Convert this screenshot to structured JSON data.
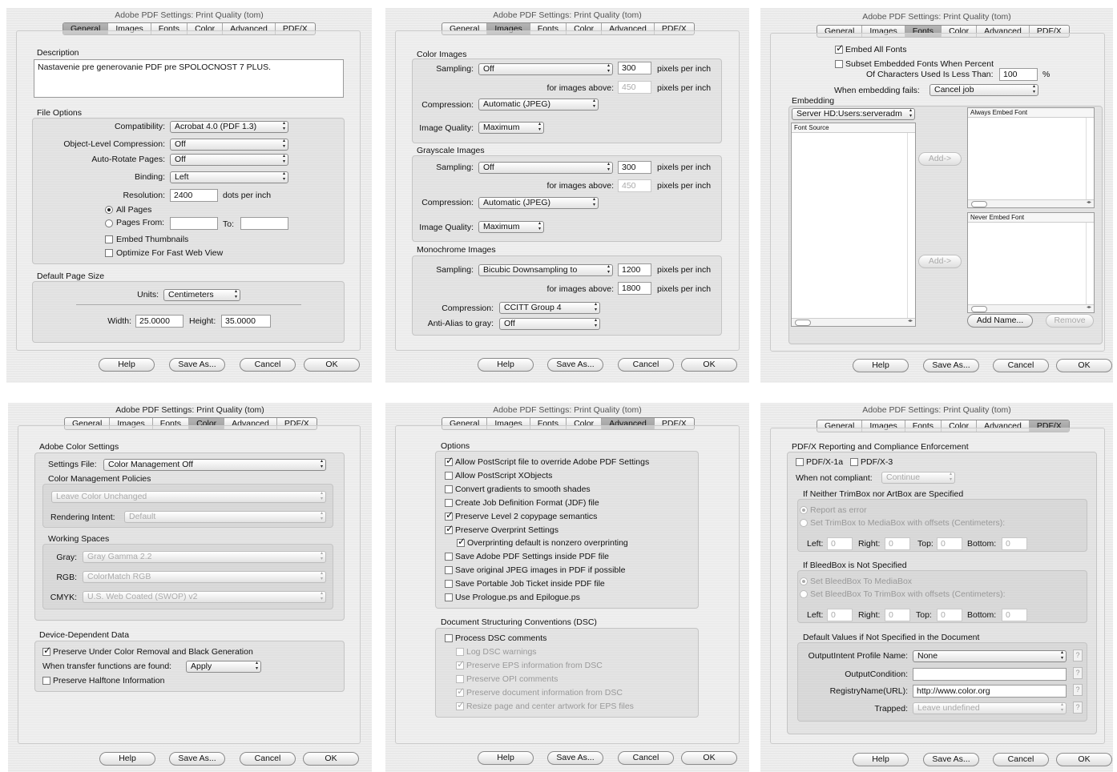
{
  "window_title": "Adobe PDF Settings: Print Quality (tom)",
  "tabs": [
    "General",
    "Images",
    "Fonts",
    "Color",
    "Advanced",
    "PDF/X"
  ],
  "buttons": {
    "help": "Help",
    "save_as": "Save As...",
    "cancel": "Cancel",
    "ok": "OK"
  },
  "general": {
    "description_label": "Description",
    "description": "Nastavenie pre generovanie PDF pre SPOLOCNOST 7 PLUS.",
    "file_options_label": "File Options",
    "compatibility_label": "Compatibility:",
    "compatibility": "Acrobat 4.0 (PDF 1.3)",
    "object_compression_label": "Object-Level Compression:",
    "object_compression": "Off",
    "auto_rotate_label": "Auto-Rotate Pages:",
    "auto_rotate": "Off",
    "binding_label": "Binding:",
    "binding": "Left",
    "resolution_label": "Resolution:",
    "resolution": "2400",
    "dpi": "dots per inch",
    "all_pages": "All Pages",
    "pages_from": "Pages From:",
    "to": "To:",
    "embed_thumbnails": "Embed Thumbnails",
    "optimize_web": "Optimize For Fast Web View",
    "page_size_label": "Default Page Size",
    "units_label": "Units:",
    "units": "Centimeters",
    "width_label": "Width:",
    "width": "25.0000",
    "height_label": "Height:",
    "height": "35.0000"
  },
  "images": {
    "color_label": "Color Images",
    "grayscale_label": "Grayscale Images",
    "mono_label": "Monochrome Images",
    "sampling_label": "Sampling:",
    "above_label": "for images above:",
    "ppi": "pixels per inch",
    "compression_label": "Compression:",
    "quality_label": "Image Quality:",
    "antialias_label": "Anti-Alias to gray:",
    "color": {
      "sampling": "Off",
      "ppi": "300",
      "above": "450",
      "compression": "Automatic (JPEG)",
      "quality": "Maximum"
    },
    "gray": {
      "sampling": "Off",
      "ppi": "300",
      "above": "450",
      "compression": "Automatic (JPEG)",
      "quality": "Maximum"
    },
    "mono": {
      "sampling": "Bicubic Downsampling to",
      "ppi": "1200",
      "above": "1800",
      "compression": "CCITT Group 4",
      "antialias": "Off"
    }
  },
  "fonts": {
    "embed_all": "Embed All Fonts",
    "subset_line1": "Subset Embedded Fonts When Percent",
    "subset_line2": "Of Characters Used Is Less Than:",
    "subset_value": "100",
    "percent": "%",
    "fails_label": "When embedding fails:",
    "fails": "Cancel job",
    "embedding_label": "Embedding",
    "source_path": "Server HD:Users:serveradm",
    "font_source": "Font Source",
    "always_embed": "Always Embed Font",
    "never_embed": "Never Embed Font",
    "add": "Add->",
    "add_name": "Add Name...",
    "remove": "Remove"
  },
  "color": {
    "adobe_label": "Adobe Color Settings",
    "settings_file_label": "Settings File:",
    "settings_file": "Color Management Off",
    "policies_label": "Color Management Policies",
    "policy": "Leave Color Unchanged",
    "intent_label": "Rendering Intent:",
    "intent": "Default",
    "working_label": "Working Spaces",
    "gray_label": "Gray:",
    "gray": "Gray Gamma 2.2",
    "rgb_label": "RGB:",
    "rgb": "ColorMatch RGB",
    "cmyk_label": "CMYK:",
    "cmyk": "U.S. Web Coated (SWOP) v2",
    "device_label": "Device-Dependent Data",
    "ucr": "Preserve Under Color Removal and Black Generation",
    "transfer_label": "When transfer functions are found:",
    "transfer": "Apply",
    "halftone": "Preserve Halftone Information"
  },
  "advanced": {
    "options_label": "Options",
    "options": [
      "Allow PostScript file to override Adobe PDF Settings",
      "Allow PostScript XObjects",
      "Convert gradients to smooth shades",
      "Create Job Definition Format (JDF) file",
      "Preserve Level 2 copypage semantics",
      "Preserve Overprint Settings",
      "Overprinting default is nonzero overprinting",
      "Save Adobe PDF Settings inside PDF file",
      "Save original JPEG images in PDF if possible",
      "Save Portable Job Ticket inside PDF file",
      "Use Prologue.ps and Epilogue.ps"
    ],
    "dsc_label": "Document Structuring Conventions (DSC)",
    "dsc_options": [
      "Process DSC comments",
      "Log DSC warnings",
      "Preserve EPS information from DSC",
      "Preserve OPI comments",
      "Preserve document information from DSC",
      "Resize page and center artwork for EPS files"
    ]
  },
  "pdfx": {
    "section_label": "PDF/X Reporting and Compliance Enforcement",
    "x1a": "PDF/X-1a",
    "x3": "PDF/X-3",
    "noncompliant_label": "When not compliant:",
    "noncompliant": "Continue",
    "trim_label": "If Neither TrimBox nor ArtBox are Specified",
    "report_error": "Report as error",
    "set_trim": "Set TrimBox to MediaBox with offsets (Centimeters):",
    "bleed_label": "If BleedBox is Not Specified",
    "set_bleed_media": "Set BleedBox To MediaBox",
    "set_bleed_trim": "Set BleedBox To TrimBox with offsets (Centimeters):",
    "left": "Left:",
    "right": "Right:",
    "top": "Top:",
    "bottom": "Bottom:",
    "zero": "0",
    "defaults_label": "Default Values if Not Specified in the Document",
    "output_intent_label": "OutputIntent Profile Name:",
    "output_intent": "None",
    "output_condition_label": "OutputCondition:",
    "registry_label": "RegistryName(URL):",
    "registry": "http://www.color.org",
    "trapped_label": "Trapped:",
    "trapped": "Leave undefined",
    "help_q": "?"
  }
}
